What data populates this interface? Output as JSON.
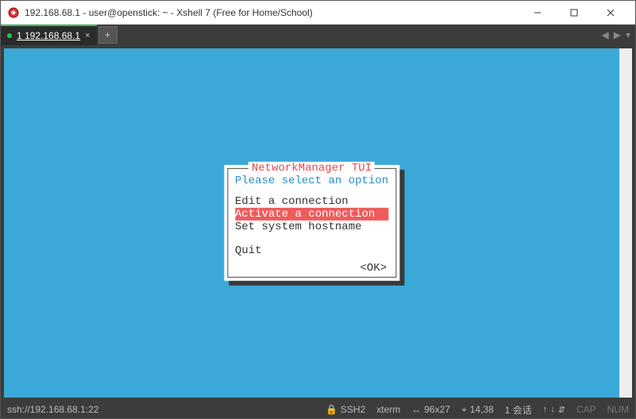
{
  "window": {
    "title": "192.168.68.1 - user@openstick: ~ - Xshell 7 (Free for Home/School)"
  },
  "tab": {
    "label": "1 192.168.68.1",
    "close_glyph": "×",
    "new_glyph": "+"
  },
  "tab_nav": {
    "left": "◀",
    "right": "▶",
    "menu": "▾"
  },
  "tui": {
    "title": "NetworkManager TUI",
    "prompt": "Please select an option",
    "items": [
      {
        "label": "Edit a connection",
        "selected": false
      },
      {
        "label": "Activate a connection",
        "selected": true
      },
      {
        "label": "Set system hostname",
        "selected": false
      }
    ],
    "quit": "Quit",
    "ok": "<OK>"
  },
  "status": {
    "ssh": "ssh://192.168.68.1:22",
    "proto": "SSH2",
    "termtype": "xterm",
    "size": "96x27",
    "cursor": "14,38",
    "sessions": "1 会话",
    "cap": "CAP",
    "num": "NUM"
  },
  "glyph": {
    "lock": "🔒",
    "resize": "↔",
    "pos": "⌖",
    "up": "↑",
    "down": "↓",
    "plusminus": "⇵"
  }
}
